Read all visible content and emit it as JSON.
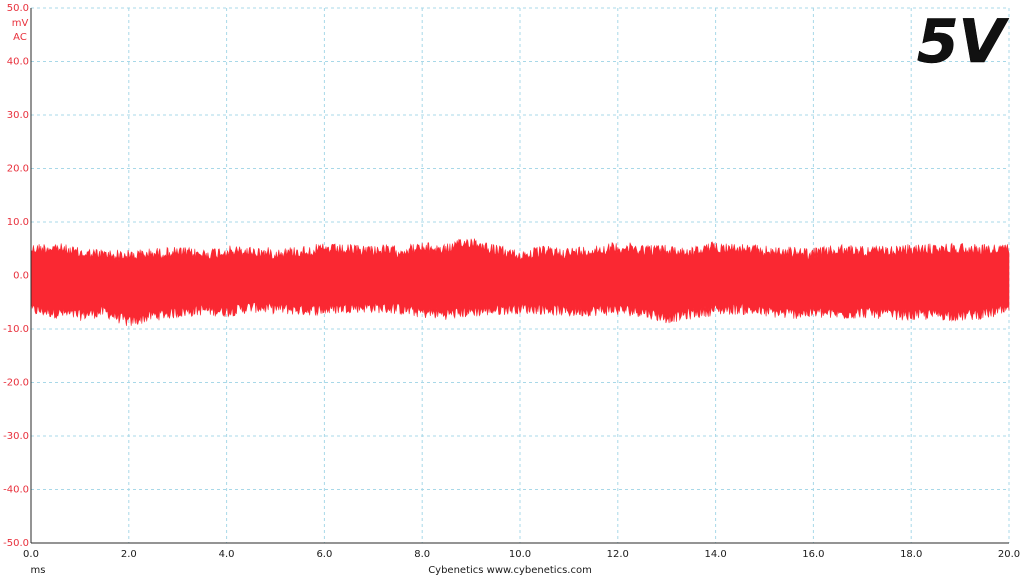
{
  "chart_data": {
    "type": "area",
    "title": "5V",
    "xlabel": "ms",
    "ylabel_unit": "mV",
    "ylabel_mode": "AC",
    "xlim": [
      0.0,
      20.0
    ],
    "ylim": [
      -50.0,
      50.0
    ],
    "x_ticks": [
      "0.0",
      "2.0",
      "4.0",
      "6.0",
      "8.0",
      "10.0",
      "12.0",
      "14.0",
      "16.0",
      "18.0",
      "20.0"
    ],
    "y_ticks": [
      "50.0",
      "40.0",
      "30.0",
      "20.0",
      "10.0",
      "0.0",
      "-10.0",
      "-20.0",
      "-30.0",
      "-40.0",
      "-50.0"
    ],
    "grid": true,
    "series": [
      {
        "color": "#fa2832",
        "x": [
          0.0,
          0.5,
          1.0,
          1.5,
          2.0,
          2.5,
          3.0,
          3.5,
          4.0,
          4.5,
          5.0,
          5.5,
          6.0,
          6.5,
          7.0,
          7.5,
          8.0,
          8.5,
          9.0,
          9.5,
          10.0,
          10.5,
          11.0,
          11.5,
          12.0,
          12.5,
          13.0,
          13.5,
          14.0,
          14.5,
          15.0,
          15.5,
          16.0,
          16.5,
          17.0,
          17.5,
          18.0,
          18.5,
          19.0,
          19.5,
          20.0
        ],
        "upper": [
          6.0,
          6.3,
          5.2,
          5.0,
          4.8,
          5.2,
          5.4,
          5.0,
          5.6,
          5.5,
          5.2,
          5.6,
          6.0,
          5.8,
          5.9,
          5.6,
          6.2,
          6.0,
          7.5,
          5.8,
          4.8,
          5.6,
          5.3,
          5.8,
          6.3,
          6.0,
          5.8,
          5.4,
          6.5,
          6.0,
          5.6,
          5.4,
          5.2,
          5.8,
          5.7,
          5.5,
          5.9,
          6.0,
          6.2,
          5.9,
          6.0
        ],
        "lower": [
          -7.5,
          -8.0,
          -8.5,
          -7.8,
          -9.8,
          -8.5,
          -8.0,
          -7.5,
          -7.8,
          -7.0,
          -7.2,
          -7.5,
          -7.5,
          -7.0,
          -7.0,
          -7.3,
          -8.0,
          -8.3,
          -7.8,
          -7.5,
          -7.2,
          -7.3,
          -7.8,
          -7.6,
          -7.5,
          -7.8,
          -9.0,
          -8.2,
          -7.5,
          -7.3,
          -7.8,
          -8.2,
          -8.0,
          -8.3,
          -8.0,
          -8.2,
          -8.5,
          -8.3,
          -8.6,
          -8.2,
          -7.5
        ]
      }
    ]
  },
  "credit": "Cybenetics   www.cybenetics.com"
}
